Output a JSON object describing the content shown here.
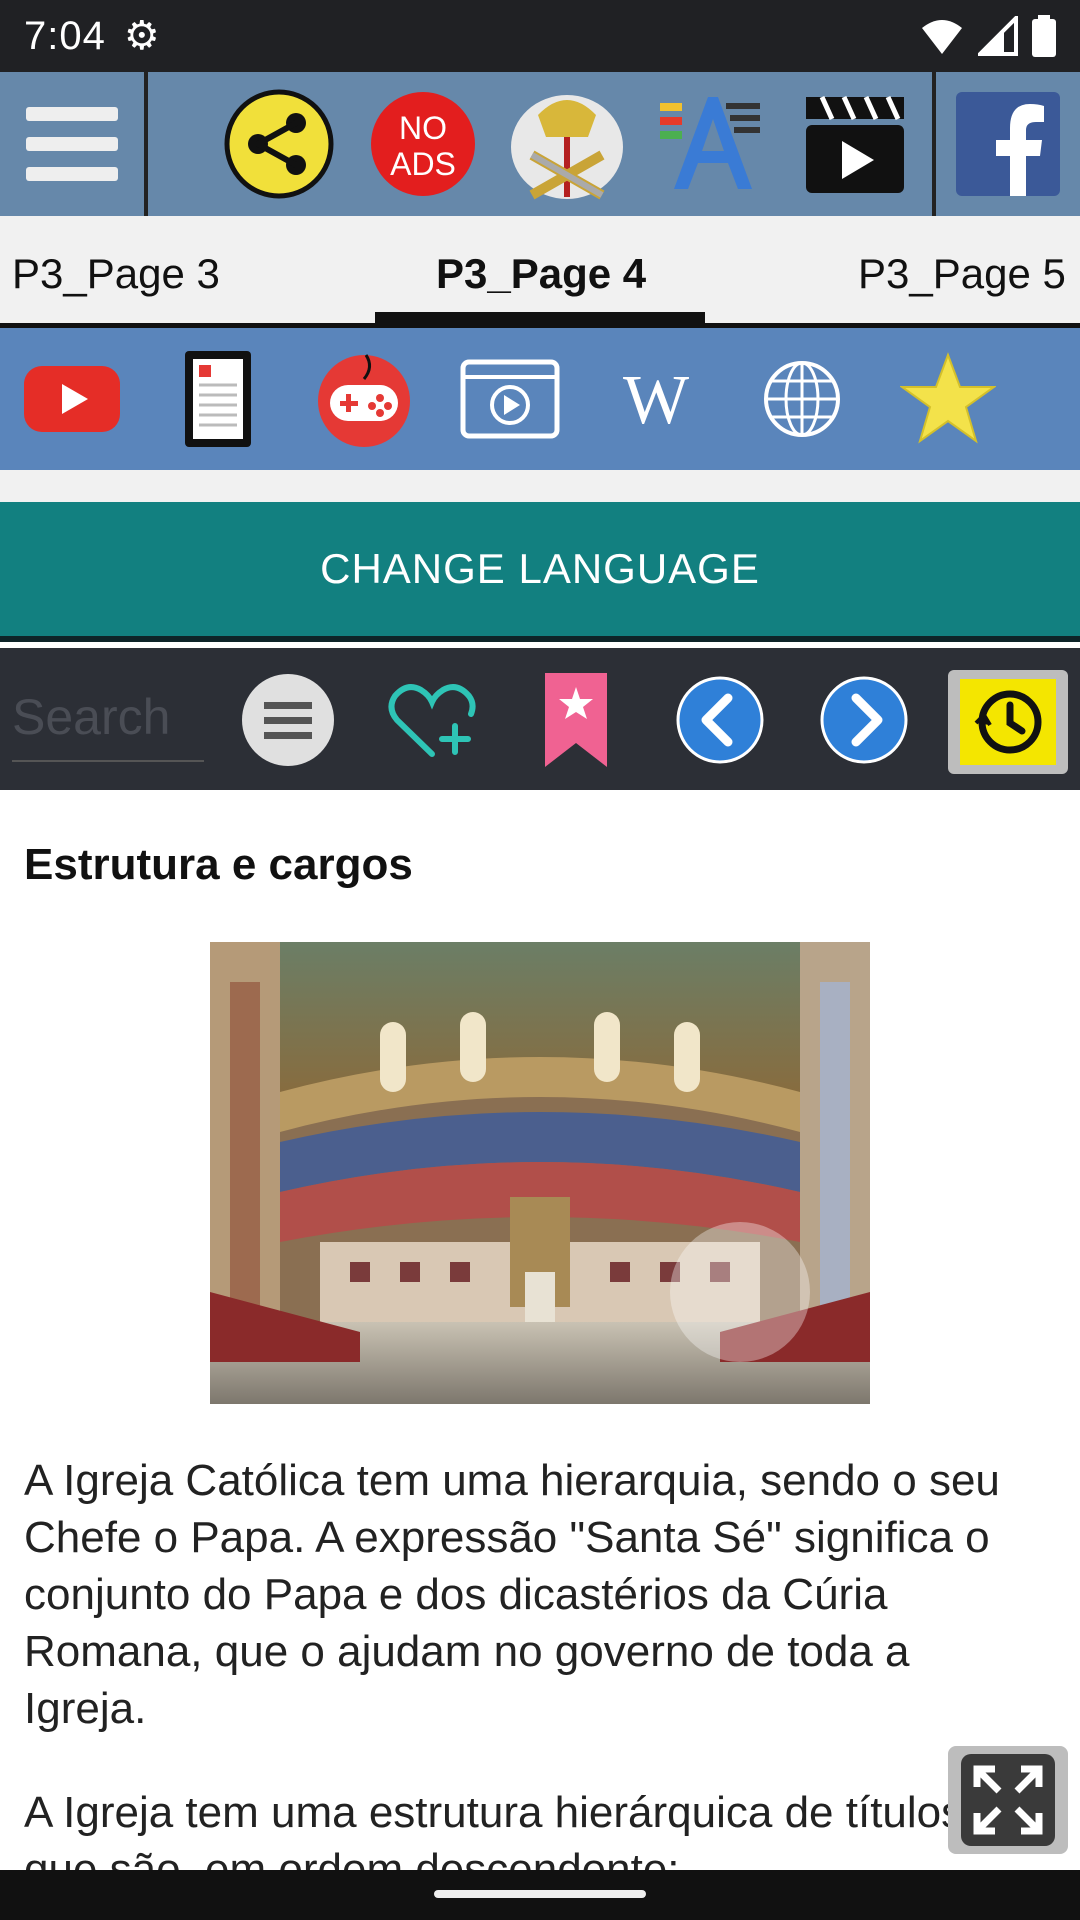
{
  "status": {
    "time": "7:04"
  },
  "topbar": {
    "icons": [
      "menu-icon",
      "share-icon",
      "no-ads-icon",
      "vatican-crest-icon",
      "font-size-icon",
      "video-icon",
      "facebook-icon"
    ],
    "no_ads_label_1": "NO",
    "no_ads_label_2": "ADS"
  },
  "tabs": [
    {
      "label": "P3_Page 3"
    },
    {
      "label": "P3_Page 4",
      "active": true
    },
    {
      "label": "P3_Page 5"
    }
  ],
  "quick_icons": [
    "youtube-icon",
    "ebook-icon",
    "gamepad-icon",
    "video-player-icon",
    "wikipedia-icon",
    "globe-icon",
    "star-icon"
  ],
  "language_button": "CHANGE LANGUAGE",
  "toolbar": {
    "search_placeholder": "Search",
    "icons": [
      "list-menu-icon",
      "favorite-add-icon",
      "bookmark-icon",
      "previous-icon",
      "next-icon",
      "history-icon"
    ]
  },
  "article": {
    "heading": "Estrutura e cargos",
    "paragraph1": "A Igreja Católica tem uma hierarquia, sendo o seu Chefe o Papa. A expressão \"Santa Sé\" significa o conjunto do Papa e dos dicastérios da Cúria Romana, que o ajudam no governo de toda a Igreja.",
    "paragraph2": "A Igreja tem uma estrutura hierárquica de títulos que são, em ordem descendente:"
  },
  "colors": {
    "topbar": "#6688aa",
    "quickbar": "#5a85bb",
    "language": "#128080",
    "toolbar": "#2c2f36"
  }
}
